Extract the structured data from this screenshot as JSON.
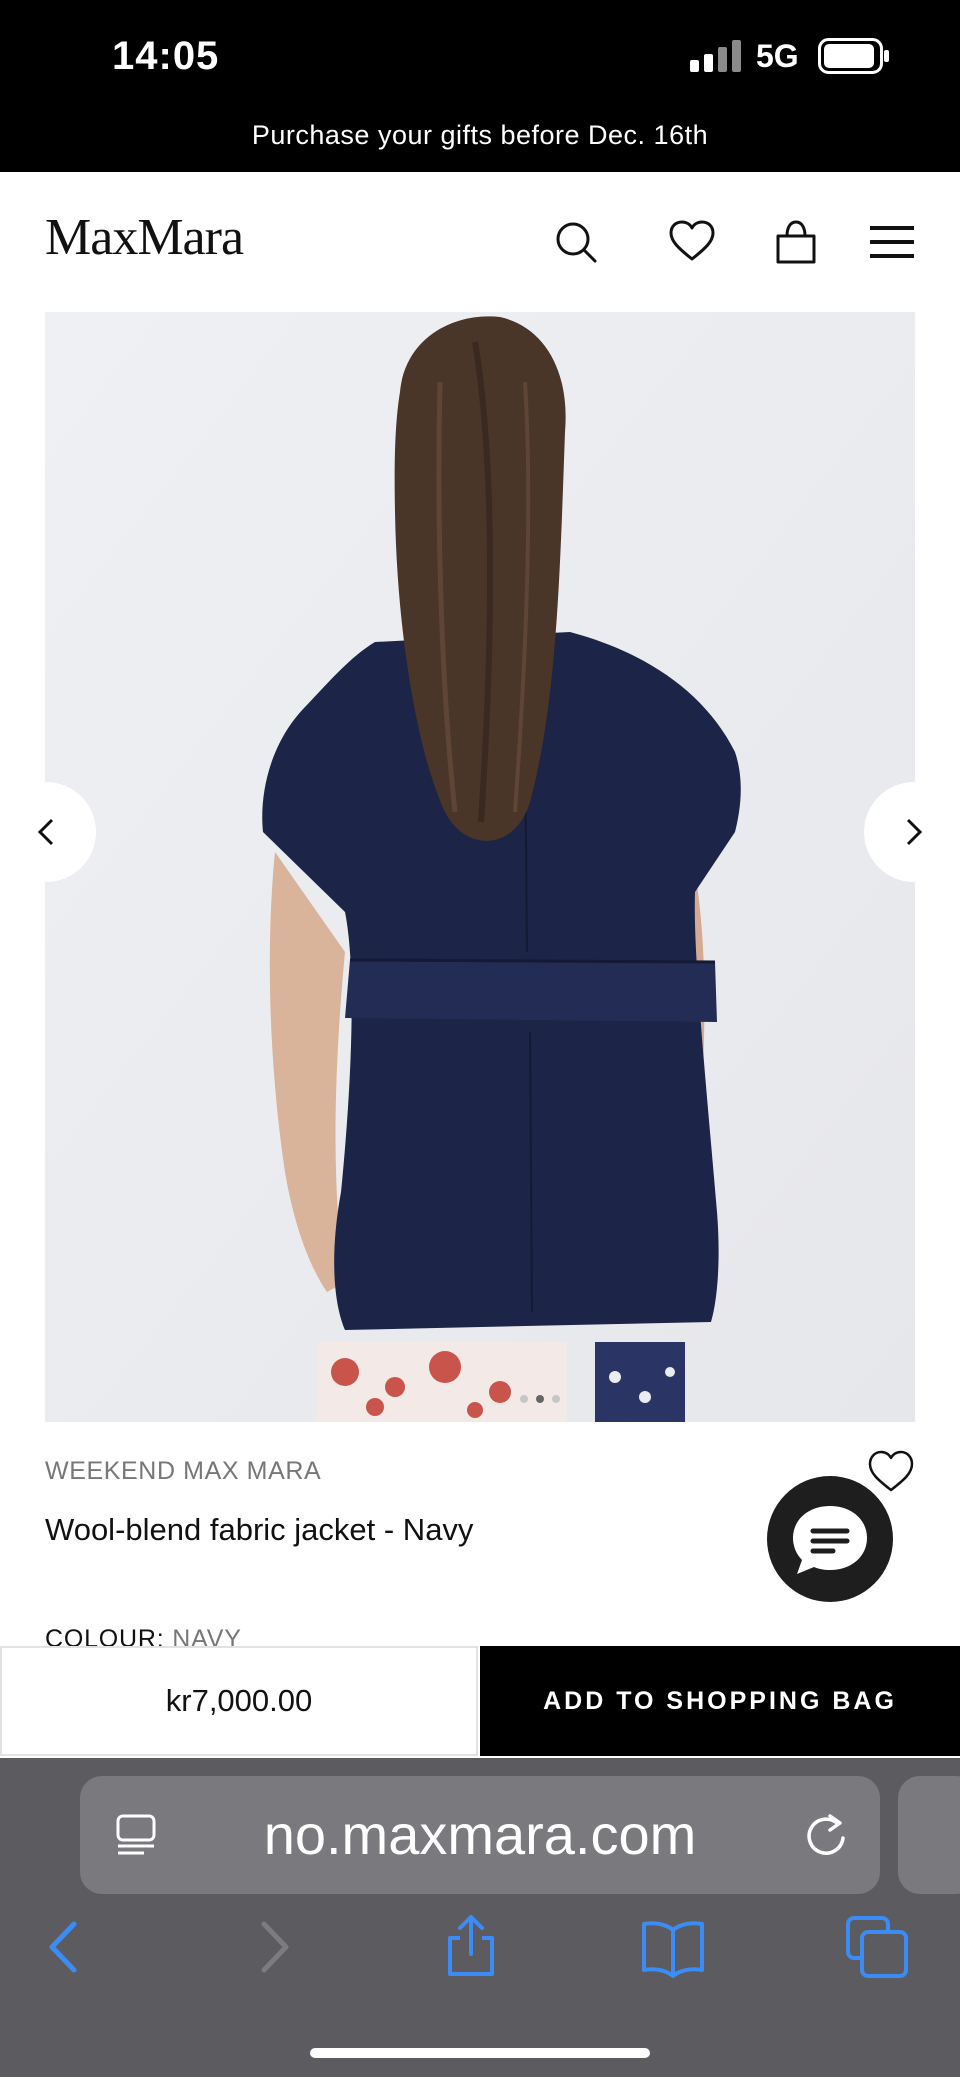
{
  "status_bar": {
    "time": "14:05",
    "network": "5G"
  },
  "promo_banner": "Purchase your gifts before Dec. 16th",
  "header": {
    "logo": "MaxMara"
  },
  "gallery": {
    "slide_count": 3,
    "active_slide": 1
  },
  "product": {
    "brand": "WEEKEND MAX MARA",
    "title": "Wool-blend fabric jacket - Navy",
    "colour_label": "COLOUR:",
    "colour_value": "NAVY",
    "price": "kr7,000.00",
    "add_to_bag_label": "ADD TO SHOPPING BAG"
  },
  "browser": {
    "url": "no.maxmara.com"
  },
  "colors": {
    "navy_jacket": "#1c2447",
    "accent_blue": "#3b8cf5",
    "chrome_gray": "#5c5c60"
  }
}
